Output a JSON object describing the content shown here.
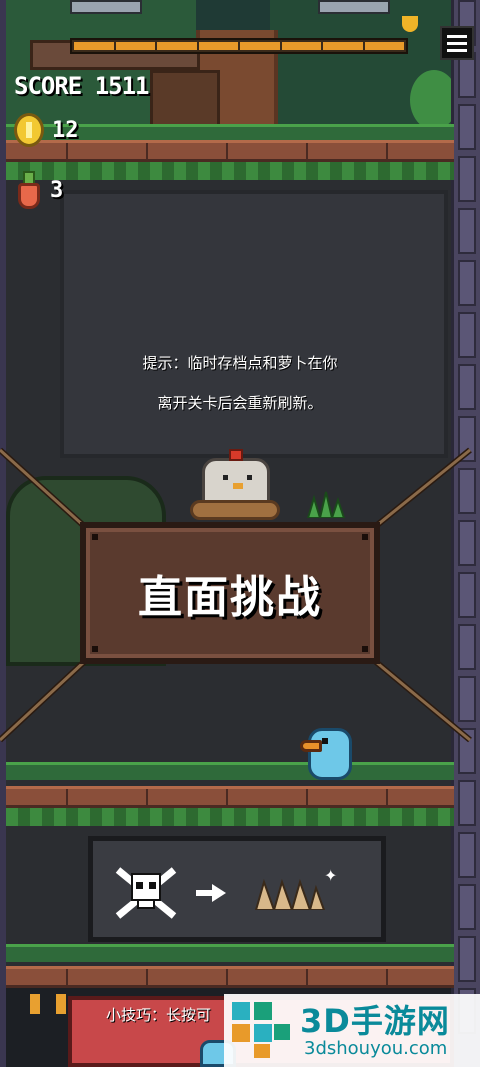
{
  "hud": {
    "score_label": "SCORE",
    "score_value": "1511",
    "coins": "12",
    "carrots": "3",
    "level_progress_segments": 8
  },
  "menu": {
    "icon": "hamburger-menu-icon"
  },
  "tip": {
    "line1": "提示：临时存档点和萝卜在你",
    "line2": "离开关卡后会重新刷新。"
  },
  "challenge_sign": {
    "label": "直面挑战"
  },
  "bottom_tip": {
    "text": "小技巧：长按可"
  },
  "watermark": {
    "title": "3D手游网",
    "url": "3dshouyou.com"
  },
  "colors": {
    "accent_orange": "#e89a2a",
    "sign_wood": "#5a3a2e",
    "grass": "#3d8a3f",
    "watermark_teal": "#0a8a9a"
  }
}
